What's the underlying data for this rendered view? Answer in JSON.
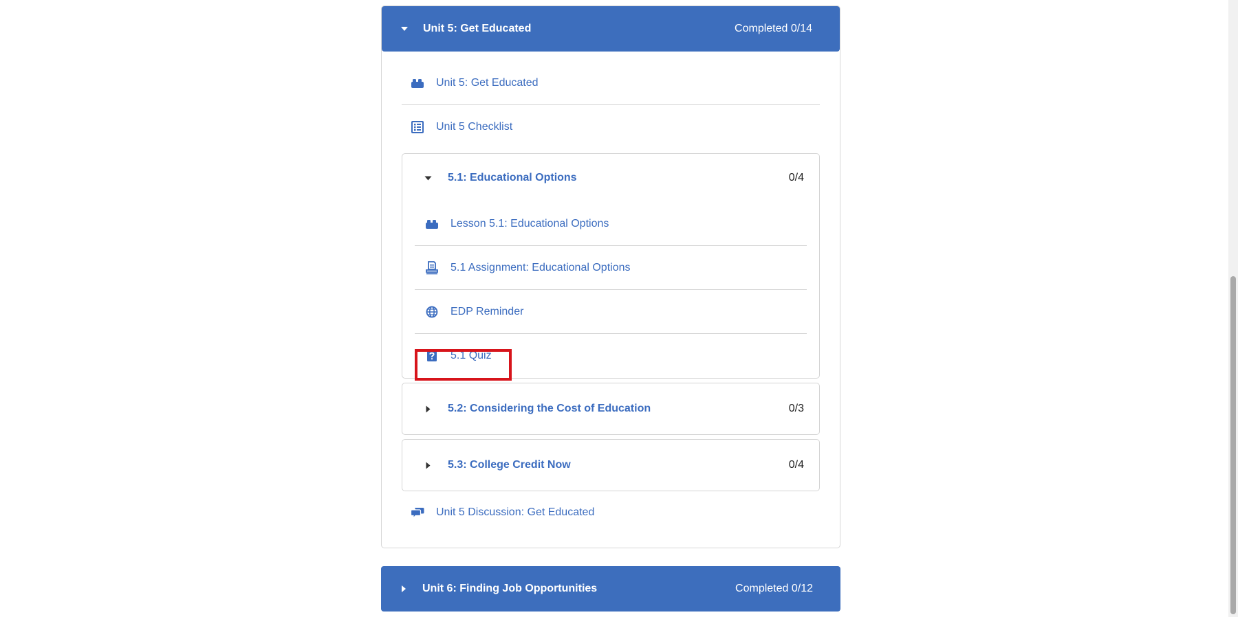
{
  "unit5": {
    "title": "Unit 5: Get Educated",
    "completed": "Completed 0/14",
    "items": [
      {
        "label": "Unit 5: Get Educated",
        "icon": "lego-block-icon"
      },
      {
        "label": "Unit 5 Checklist",
        "icon": "checklist-icon"
      }
    ],
    "subunits": [
      {
        "title": "5.1: Educational Options",
        "count": "0/4",
        "expanded": true,
        "items": [
          {
            "label": "Lesson 5.1: Educational Options",
            "icon": "lego-block-icon"
          },
          {
            "label": "5.1 Assignment: Educational Options",
            "icon": "assignment-icon"
          },
          {
            "label": "EDP Reminder",
            "icon": "globe-icon"
          },
          {
            "label": "5.1 Quiz",
            "icon": "quiz-icon"
          }
        ]
      },
      {
        "title": "5.2: Considering the Cost of Education",
        "count": "0/3",
        "expanded": false
      },
      {
        "title": "5.3: College Credit Now",
        "count": "0/4",
        "expanded": false
      }
    ],
    "discussion": {
      "label": "Unit 5 Discussion: Get Educated",
      "icon": "discussion-icon"
    }
  },
  "unit6": {
    "title": "Unit 6: Finding Job Opportunities",
    "completed": "Completed 0/12"
  },
  "colors": {
    "header_bg": "#3d6ebd",
    "link": "#3b6cbf",
    "highlight": "#d7141b"
  }
}
